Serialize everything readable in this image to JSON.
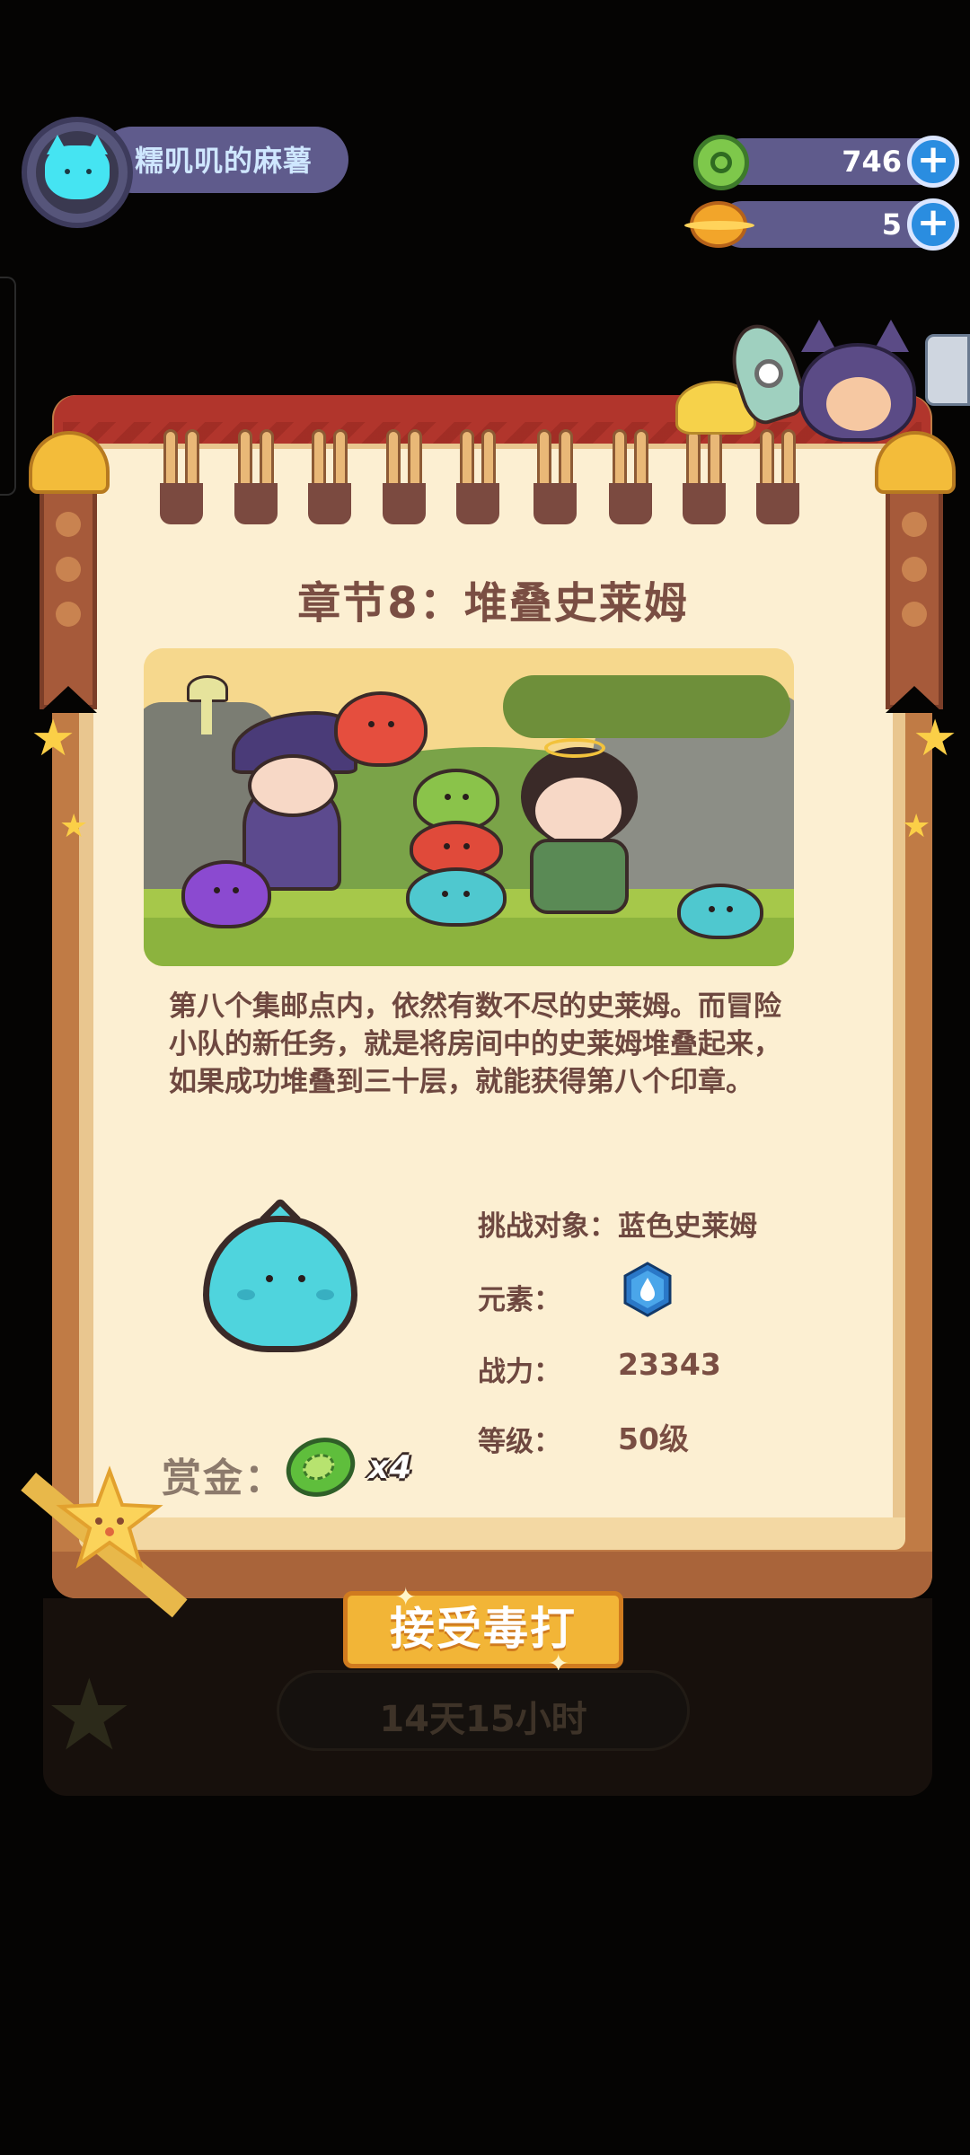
{
  "profile": {
    "name": "糯叽叽的麻薯",
    "avatar": "cyan-cat-avatar"
  },
  "currencies": [
    {
      "icon": "green-donut-coin-icon",
      "value": "746",
      "plus": "+"
    },
    {
      "icon": "gold-planet-coin-icon",
      "value": "5",
      "plus": "+"
    }
  ],
  "chapter": {
    "title": "章节8：堆叠史莱姆",
    "description": "第八个集邮点内，依然有数不尽的史莱姆。而冒险小队的新任务，就是将房间中的史莱姆堆叠起来，如果成功堆叠到三十层，就能获得第八个印章。"
  },
  "challenge": {
    "target_label": "挑战对象：",
    "target_value": "蓝色史莱姆",
    "element_label": "元素：",
    "element_icon": "water-drop-hex-icon",
    "power_label": "战力：",
    "power_value": "23343",
    "level_label": "等级：",
    "level_value": "50级"
  },
  "bounty": {
    "label": "赏金：",
    "icon": "cucumber-icon",
    "count": "x4"
  },
  "actions": {
    "accept_label": "接受毒打",
    "timer": "14天15小时"
  },
  "colors": {
    "page": "#fcefd2",
    "title": "#7a4e43",
    "button": "#f2b537",
    "button_border": "#d07b1f",
    "wood": "#c07b45",
    "band": "#b1352c"
  }
}
